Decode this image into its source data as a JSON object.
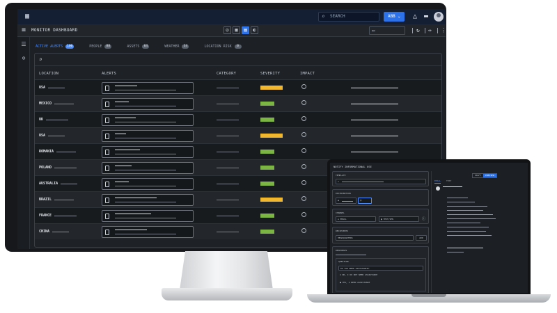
{
  "dashboard": {
    "topbar": {
      "search_placeholder": "SEARCH",
      "org_button": "ABB"
    },
    "title": "MONITOR DASHBOARD",
    "tabs": [
      {
        "label": "ACTIVE ALERTS",
        "count": "100",
        "active": true
      },
      {
        "label": "PEOPLE",
        "count": "88",
        "active": false
      },
      {
        "label": "ASSETS",
        "count": "64",
        "active": false
      },
      {
        "label": "WEATHER",
        "count": "34",
        "active": false
      },
      {
        "label": "LOCATION RISK",
        "count": "0",
        "active": false
      }
    ],
    "columns": [
      "LOCATION",
      "ALERTS",
      "CATEGORY",
      "SEVERITY",
      "IMPACT"
    ],
    "rows": [
      {
        "location": "USA",
        "severity": "high"
      },
      {
        "location": "MEXICO",
        "severity": "low"
      },
      {
        "location": "UK",
        "severity": "low"
      },
      {
        "location": "USA",
        "severity": "high"
      },
      {
        "location": "ROMANIA",
        "severity": "low"
      },
      {
        "location": "POLAND",
        "severity": "low"
      },
      {
        "location": "AUSTRALIA",
        "severity": "low"
      },
      {
        "location": "BRAZIL",
        "severity": "high"
      },
      {
        "location": "FRANCE",
        "severity": "low"
      },
      {
        "location": "CHINA",
        "severity": "low"
      }
    ],
    "colors": {
      "accent": "#2e72ea",
      "severity_high": "#f0b72f",
      "severity_low": "#7db544"
    }
  },
  "laptop": {
    "title": "NOTIFY INFORMATIONAL USE",
    "cards": {
      "template": "TEMPLATE",
      "distribution": "DISTRIBUTION",
      "channel": "CHANNEL",
      "channel_email": "EMAIL",
      "channel_text": "TEXT/SMS",
      "recipients": "RECIPIENTS",
      "recipient_value": "HEADQUARTERS",
      "add_button": "ADD",
      "responses": "RESPONSES",
      "question": "QUESTION",
      "question_text": "DO YOU NEED ASSISTANCE?",
      "option_no": "NO, I DO NOT NEED ASSISTANCE",
      "option_yes": "YES, I NEED ASSISTANCE"
    },
    "preview_tabs": [
      "EMAIL",
      "TEXT"
    ],
    "segment": [
      "DRAFT",
      "PREVIEW"
    ]
  }
}
